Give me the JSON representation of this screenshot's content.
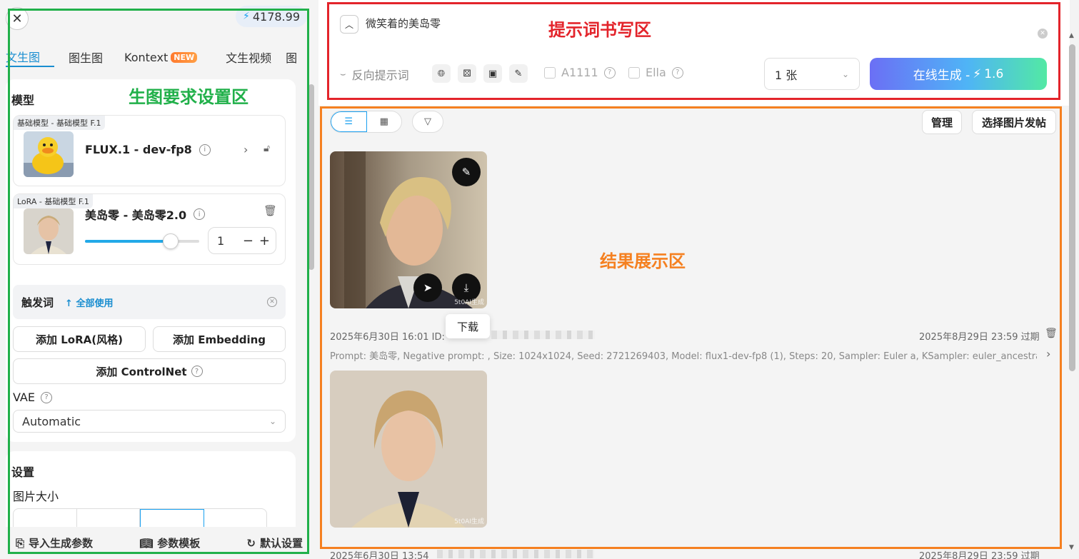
{
  "left": {
    "credits": "4178.99",
    "tabs": [
      "文生图",
      "图生图",
      "Kontext",
      "文生视频",
      "图"
    ],
    "new_badge": "NEW",
    "model_section_title": "模型",
    "base_model": {
      "tag": "基础模型 - 基础模型 F.1",
      "name": "FLUX.1 - dev-fp8"
    },
    "lora": {
      "tag": "LoRA - 基础模型 F.1",
      "name": "美岛零 - 美岛零2.0",
      "weight": "1",
      "slider_fraction": 0.75
    },
    "trigger": {
      "label": "触发词",
      "use_all": "全部使用"
    },
    "buttons": {
      "add_lora": "添加 LoRA(风格)",
      "add_embedding": "添加 Embedding",
      "add_controlnet": "添加 ControlNet"
    },
    "vae": {
      "label": "VAE",
      "value": "Automatic"
    },
    "settings_title": "设置",
    "image_size_label": "图片大小",
    "bottom": {
      "import": "导入生成参数",
      "template": "参数模板",
      "default": "默认设置"
    }
  },
  "prompt": {
    "text": "微笑着的美岛零",
    "negative_label": "反向提示词",
    "a1111_label": "A1111",
    "ella_label": "Ella",
    "count": "1 张",
    "generate_label": "在线生成 -",
    "generate_cost": "1.6"
  },
  "results": {
    "manage_label": "管理",
    "post_label": "选择图片发帖",
    "tooltip": "下载",
    "item1": {
      "date": "2025年6月30日 16:01 ID:",
      "expire": "2025年8月29日 23:59 过期",
      "prompt": "Prompt: 美岛零, Negative prompt: , Size: 1024x1024, Seed: 2721269403, Model: flux1-dev-fp8 (1), Steps: 20, Sampler: Euler a, KSampler: euler_ancestral,..."
    },
    "item2": {
      "date": "2025年6月30日 13:54",
      "expire": "2025年8月29日 23:59 过期"
    },
    "watermark": "5t0AI生成"
  },
  "annotations": {
    "prompt_zone": "提示词书写区",
    "settings_zone": "生图要求设置区",
    "result_zone": "结果展示区"
  },
  "colors": {
    "accent": "#1a8ed0",
    "red_frame": "#e3242b",
    "green_frame": "#21b04a",
    "orange_frame": "#f58020"
  }
}
